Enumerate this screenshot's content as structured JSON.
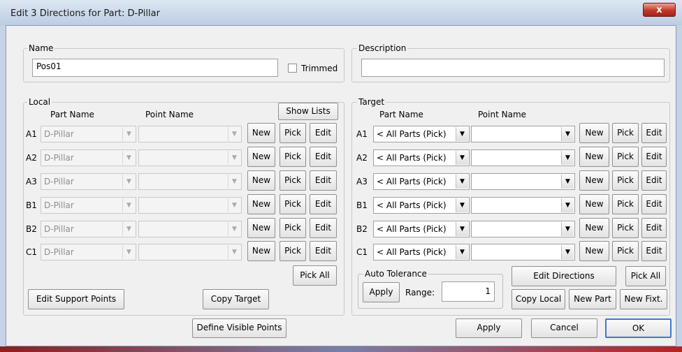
{
  "window": {
    "title": "Edit 3 Directions for Part: D-Pillar",
    "close_glyph": "x"
  },
  "name_group": {
    "legend": "Name",
    "value": "Pos01",
    "trimmed_label": "Trimmed",
    "trimmed_checked": false
  },
  "description_group": {
    "legend": "Description",
    "value": ""
  },
  "local": {
    "legend": "Local",
    "show_lists": "Show Lists",
    "part_header": "Part Name",
    "point_header": "Point Name",
    "rows": [
      {
        "label": "A1",
        "part": "D-Pillar",
        "point": "",
        "new": "New",
        "pick": "Pick",
        "edit": "Edit"
      },
      {
        "label": "A2",
        "part": "D-Pillar",
        "point": "",
        "new": "New",
        "pick": "Pick",
        "edit": "Edit"
      },
      {
        "label": "A3",
        "part": "D-Pillar",
        "point": "",
        "new": "New",
        "pick": "Pick",
        "edit": "Edit"
      },
      {
        "label": "B1",
        "part": "D-Pillar",
        "point": "",
        "new": "New",
        "pick": "Pick",
        "edit": "Edit"
      },
      {
        "label": "B2",
        "part": "D-Pillar",
        "point": "",
        "new": "New",
        "pick": "Pick",
        "edit": "Edit"
      },
      {
        "label": "C1",
        "part": "D-Pillar",
        "point": "",
        "new": "New",
        "pick": "Pick",
        "edit": "Edit"
      }
    ],
    "pick_all": "Pick All",
    "edit_support_points": "Edit Support Points",
    "copy_target": "Copy Target"
  },
  "target": {
    "legend": "Target",
    "part_header": "Part Name",
    "point_header": "Point Name",
    "rows": [
      {
        "label": "A1",
        "part": "< All Parts (Pick)",
        "point": "",
        "new": "New",
        "pick": "Pick",
        "edit": "Edit"
      },
      {
        "label": "A2",
        "part": "< All Parts (Pick)",
        "point": "",
        "new": "New",
        "pick": "Pick",
        "edit": "Edit"
      },
      {
        "label": "A3",
        "part": "< All Parts (Pick)",
        "point": "",
        "new": "New",
        "pick": "Pick",
        "edit": "Edit"
      },
      {
        "label": "B1",
        "part": "< All Parts (Pick)",
        "point": "",
        "new": "New",
        "pick": "Pick",
        "edit": "Edit"
      },
      {
        "label": "B2",
        "part": "< All Parts (Pick)",
        "point": "",
        "new": "New",
        "pick": "Pick",
        "edit": "Edit"
      },
      {
        "label": "C1",
        "part": "< All Parts (Pick)",
        "point": "",
        "new": "New",
        "pick": "Pick",
        "edit": "Edit"
      }
    ],
    "auto_tolerance": {
      "legend": "Auto Tolerance",
      "apply": "Apply",
      "range_label": "Range:",
      "range_value": "1"
    },
    "edit_directions": "Edit Directions",
    "pick_all": "Pick All",
    "copy_local": "Copy Local",
    "new_part": "New Part",
    "new_fixt": "New Fixt."
  },
  "footer": {
    "define_visible_points": "Define Visible Points",
    "apply": "Apply",
    "cancel": "Cancel",
    "ok": "OK"
  },
  "icons": {
    "dropdown": "chevron-down-icon",
    "close": "close-icon",
    "checkbox": "checkbox-icon"
  }
}
